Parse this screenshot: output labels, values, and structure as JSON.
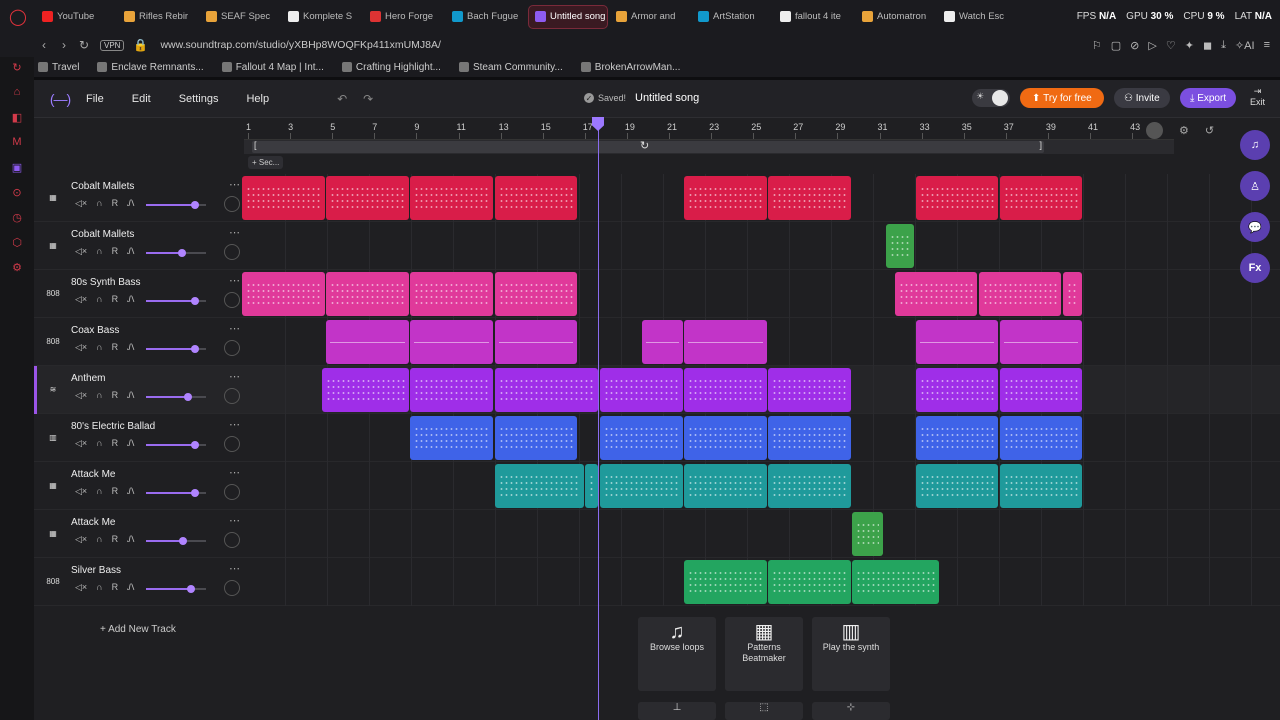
{
  "browser": {
    "tabs": [
      {
        "label": "",
        "icon": "",
        "color": "#1b1b1f"
      },
      {
        "label": "YouTube",
        "icon": "youtube-icon",
        "color": "#e22"
      },
      {
        "label": "Rifles Rebir",
        "icon": "folder-icon",
        "color": "#e8a33a"
      },
      {
        "label": "SEAF Spec",
        "icon": "folder-icon",
        "color": "#e8a33a"
      },
      {
        "label": "Komplete S",
        "icon": "komplete-icon",
        "color": "#eee"
      },
      {
        "label": "Hero Forge",
        "icon": "heroforge-icon",
        "color": "#d33"
      },
      {
        "label": "Bach Fugue",
        "icon": "shazam-icon",
        "color": "#19c"
      },
      {
        "label": "Untitled song - S",
        "icon": "soundtrap-icon",
        "color": "#8e5bf0",
        "active": true
      },
      {
        "label": "Armor and",
        "icon": "folder-icon",
        "color": "#e8a33a"
      },
      {
        "label": "ArtStation",
        "icon": "artstation-icon",
        "color": "#19c"
      },
      {
        "label": "fallout 4 ite",
        "icon": "google-icon",
        "color": "#eee"
      },
      {
        "label": "Automatron",
        "icon": "folder-icon",
        "color": "#e8a33a"
      },
      {
        "label": "Watch Esc",
        "icon": "amazon-icon",
        "color": "#eee"
      }
    ],
    "perf": {
      "fps_label": "FPS",
      "fps": "N/A",
      "gpu_label": "GPU",
      "gpu": "30 %",
      "cpu_label": "CPU",
      "cpu": "9 %",
      "lat_label": "LAT",
      "lat": "N/A"
    },
    "vpn": "VPN",
    "url": "www.soundtrap.com/studio/yXBHp8WOQFKp411xmUMJ8A/",
    "bookmarks": [
      "Travel",
      "Enclave Remnants...",
      "Fallout 4 Map | Int...",
      "Crafting Highlight...",
      "Steam Community...",
      "BrokenArrowMan..."
    ]
  },
  "app": {
    "menu": {
      "file": "File",
      "edit": "Edit",
      "settings": "Settings",
      "help": "Help"
    },
    "saved": "Saved!",
    "song_title": "Untitled song",
    "try_free": "Try for free",
    "invite": "Invite",
    "export": "Export",
    "exit": "Exit",
    "section_label": "+ Sec...",
    "add_track": "+ Add New Track",
    "ruler_ticks": [
      "1",
      "3",
      "5",
      "7",
      "9",
      "11",
      "13",
      "15",
      "17",
      "19",
      "21",
      "23",
      "25",
      "27",
      "29",
      "31",
      "33",
      "35",
      "37",
      "39",
      "41",
      "43"
    ],
    "track_controls": {
      "mute": "🔇",
      "headphones": "🎧",
      "rec": "R",
      "fx": "ᔕ"
    },
    "cards": [
      {
        "title": "Browse loops",
        "icon": "music-note-icon",
        "glyph": "♫"
      },
      {
        "title": "Patterns Beatmaker",
        "icon": "patterns-icon",
        "glyph": "▦"
      },
      {
        "title": "Play the synth",
        "icon": "piano-icon",
        "glyph": "▥"
      }
    ],
    "right_tools": [
      {
        "name": "loops-tool-icon",
        "glyph": "♫"
      },
      {
        "name": "collab-tool-icon",
        "glyph": "♙"
      },
      {
        "name": "chat-tool-icon",
        "glyph": "💬"
      },
      {
        "name": "fx-tool-icon",
        "glyph": "Fx"
      }
    ]
  },
  "colors": {
    "red": "#d91d49",
    "pink": "#e0399a",
    "magenta": "#c234c8",
    "purple": "#9f2ee8",
    "blue": "#3f63e8",
    "teal": "#1f9a9b",
    "green": "#23a560",
    "light_green": "#3ca24a"
  },
  "tracks": [
    {
      "name": "Cobalt Mallets",
      "icon": "keyboard-icon",
      "glyph": "▦",
      "vol": 0.82,
      "color": "red",
      "clips": [
        [
          0,
          4
        ],
        [
          4,
          8
        ],
        [
          8,
          12
        ],
        [
          12,
          16
        ],
        [
          21,
          25
        ],
        [
          25,
          29
        ],
        [
          32,
          36
        ],
        [
          36,
          40
        ]
      ]
    },
    {
      "name": "Cobalt Mallets",
      "icon": "keyboard-icon",
      "glyph": "▦",
      "vol": 0.6,
      "color": "light_green",
      "clips": [
        [
          30.6,
          32
        ]
      ]
    },
    {
      "name": "80s Synth Bass",
      "icon": "drum-808-icon",
      "glyph": "808",
      "vol": 0.82,
      "color": "pink",
      "clips": [
        [
          0,
          4
        ],
        [
          4,
          8
        ],
        [
          8,
          12
        ],
        [
          12,
          16
        ],
        [
          31,
          35
        ],
        [
          35,
          39
        ],
        [
          39,
          40
        ]
      ]
    },
    {
      "name": "Coax Bass",
      "icon": "drum-808-icon",
      "glyph": "808",
      "vol": 0.82,
      "color": "magenta",
      "clips": [
        [
          4,
          8
        ],
        [
          8,
          12
        ],
        [
          12,
          16
        ],
        [
          19,
          21
        ],
        [
          21,
          25
        ],
        [
          32,
          36
        ],
        [
          36,
          40
        ]
      ],
      "style": "line"
    },
    {
      "name": "Anthem",
      "icon": "synth-icon",
      "glyph": "≋",
      "vol": 0.7,
      "color": "purple",
      "selected": true,
      "clips": [
        [
          3.8,
          8
        ],
        [
          8,
          12
        ],
        [
          12,
          17
        ],
        [
          17,
          21
        ],
        [
          21,
          25
        ],
        [
          25,
          29
        ],
        [
          32,
          36
        ],
        [
          36,
          40
        ]
      ]
    },
    {
      "name": "80's Electric Ballad",
      "icon": "keyboard-icon",
      "glyph": "▥",
      "vol": 0.82,
      "color": "blue",
      "clips": [
        [
          8,
          12
        ],
        [
          12,
          16
        ],
        [
          17,
          21
        ],
        [
          21,
          25
        ],
        [
          25,
          29
        ],
        [
          32,
          36
        ],
        [
          36,
          40
        ]
      ]
    },
    {
      "name": "Attack Me",
      "icon": "keyboard-icon",
      "glyph": "▦",
      "vol": 0.82,
      "color": "teal",
      "clips": [
        [
          12,
          16.3
        ],
        [
          16.3,
          17
        ],
        [
          17,
          21
        ],
        [
          21,
          25
        ],
        [
          25,
          29
        ],
        [
          32,
          36
        ],
        [
          36,
          40
        ]
      ]
    },
    {
      "name": "Attack Me",
      "icon": "keyboard-icon",
      "glyph": "▦",
      "vol": 0.62,
      "color": "light_green",
      "clips": [
        [
          29,
          30.5
        ]
      ]
    },
    {
      "name": "Silver Bass",
      "icon": "drum-808-icon",
      "glyph": "808",
      "vol": 0.75,
      "color": "green",
      "clips": [
        [
          21,
          25
        ],
        [
          25,
          29
        ],
        [
          29,
          33.2
        ]
      ]
    }
  ]
}
